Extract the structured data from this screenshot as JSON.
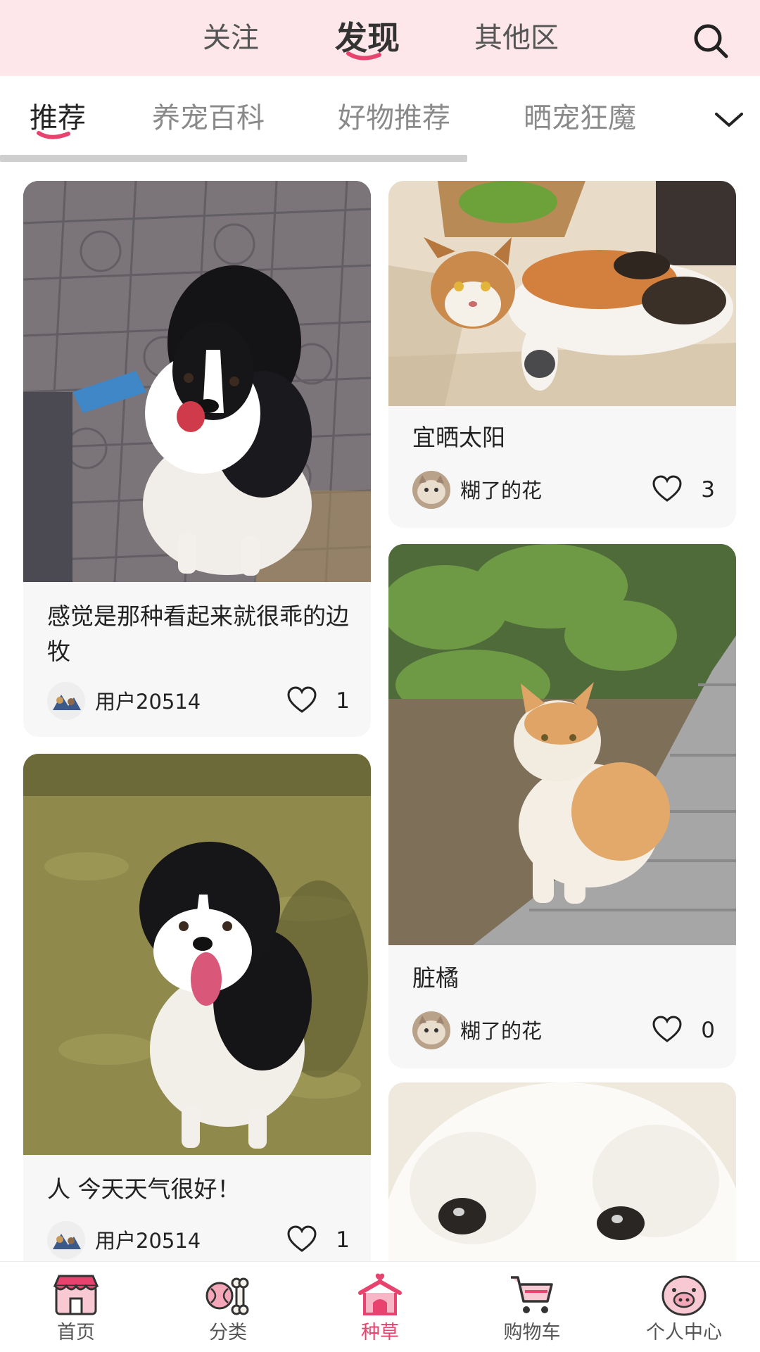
{
  "header": {
    "tabs": [
      {
        "label": "关注",
        "active": false
      },
      {
        "label": "发现",
        "active": true
      },
      {
        "label": "其他区",
        "active": false
      }
    ],
    "search_icon": "search-icon"
  },
  "categories": {
    "tabs": [
      {
        "label": "推荐",
        "active": true
      },
      {
        "label": "养宠百科",
        "active": false
      },
      {
        "label": "好物推荐",
        "active": false
      },
      {
        "label": "晒宠狂魔",
        "active": false
      }
    ],
    "more_icon": "chevron-down-icon"
  },
  "feed": {
    "left": [
      {
        "title": "感觉是那种看起来就很乖的边牧",
        "author": "用户20514",
        "likes": "1",
        "image": "border-collie-on-tiles"
      },
      {
        "title": "人 今天天气很好！",
        "author": "用户20514",
        "likes": "1",
        "image": "border-collie-on-grass"
      }
    ],
    "right": [
      {
        "title": "宜晒太阳",
        "author": "糊了的花",
        "likes": "3",
        "image": "calico-cat-sunbathing"
      },
      {
        "title": "脏橘",
        "author": "糊了的花",
        "likes": "0",
        "image": "orange-white-cat-by-path"
      },
      {
        "title": "",
        "author": "",
        "likes": "",
        "image": "white-fluffy-dog-closeup"
      }
    ]
  },
  "bottom_nav": {
    "items": [
      {
        "label": "首页",
        "icon": "shop-icon",
        "active": false
      },
      {
        "label": "分类",
        "icon": "ball-bone-icon",
        "active": false
      },
      {
        "label": "种草",
        "icon": "pet-house-icon",
        "active": true
      },
      {
        "label": "购物车",
        "icon": "cart-icon",
        "active": false
      },
      {
        "label": "个人中心",
        "icon": "pig-face-icon",
        "active": false
      }
    ]
  },
  "colors": {
    "accent": "#e8436e",
    "header_bg": "#fde7ea",
    "card_bg": "#f7f7f7"
  }
}
